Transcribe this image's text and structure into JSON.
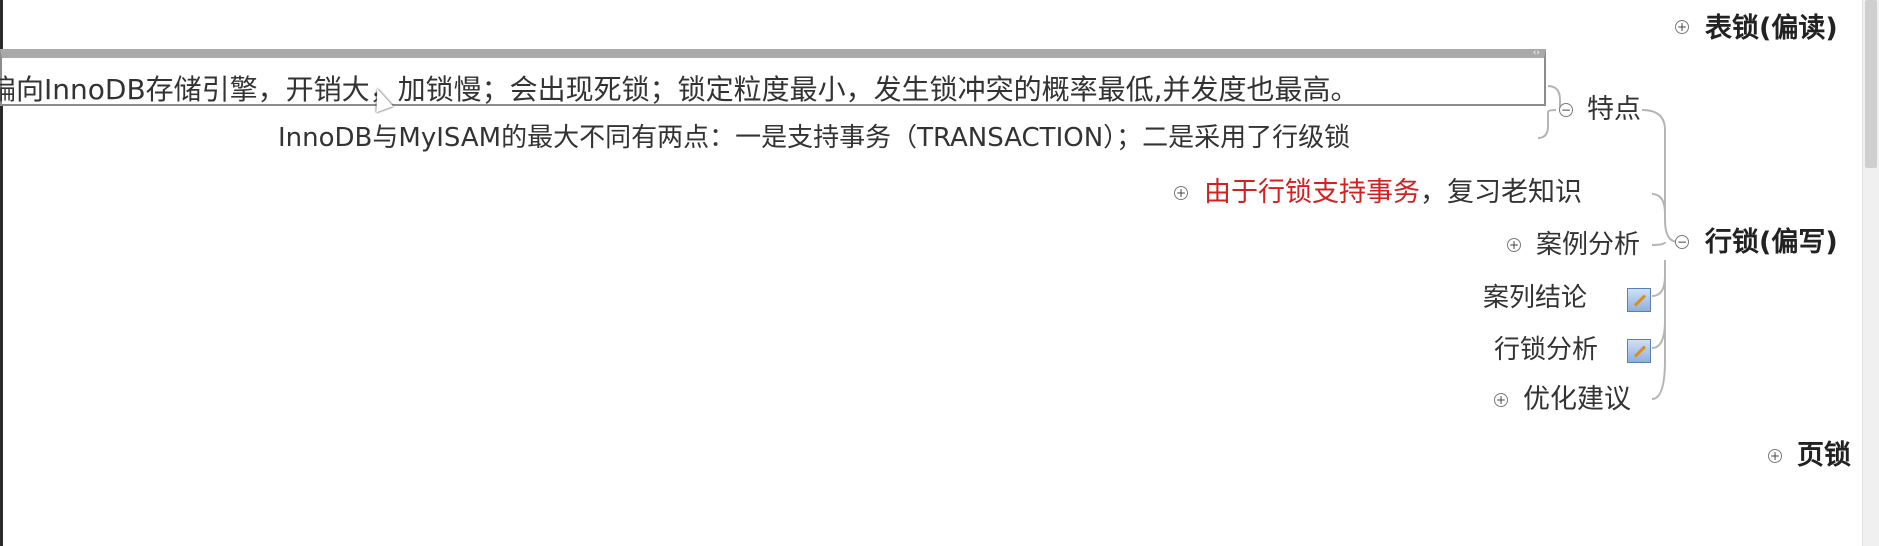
{
  "mindmap": {
    "table_lock": {
      "label": "表锁(偏读)"
    },
    "edit_text": "偏向InnoDB存储引擎，开销大，加锁慢；会出现死锁；锁定粒度最小，发生锁冲突的概率最低,并发度也最高。",
    "features": {
      "label": "特点"
    },
    "innodb_diff": "InnoDB与MyISAM的最大不同有两点：一是支持事务（TRANSACTION）；二是采用了行级锁",
    "review": {
      "highlight": "由于行锁支持事务",
      "rest": "，复习老知识"
    },
    "case_analysis": "案例分析",
    "row_lock": {
      "label": "行锁(偏写)"
    },
    "case_conclusion": "案列结论",
    "row_lock_analysis": "行锁分析",
    "optimization": "优化建议",
    "page_lock": {
      "label": "页锁"
    },
    "symbols": {
      "expand": "+",
      "collapse": "−",
      "grip": "‹›"
    }
  },
  "colors": {
    "highlight": "#d42020",
    "connector": "#b5b5b5",
    "edit_border": "#a9a9a9"
  }
}
